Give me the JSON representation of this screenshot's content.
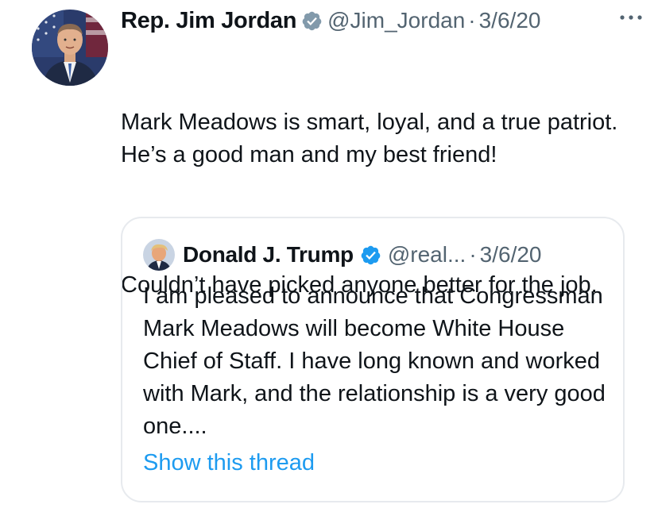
{
  "tweet": {
    "author_name": "Rep. Jim Jordan",
    "handle": "@Jim_Jordan",
    "separator": "·",
    "date": "3/6/20",
    "verified_icon": "verified-badge-icon",
    "more_icon": "more-options-icon",
    "text_paragraphs": [
      "Mark Meadows is smart, loyal, and a true patriot. He’s a good man and my best friend!",
      "Couldn’t have picked anyone better for the job."
    ]
  },
  "quoted_tweet": {
    "author_name": "Donald J. Trump",
    "handle": "@real...",
    "separator": "·",
    "date": "3/6/20",
    "verified_icon": "verified-badge-icon",
    "text": "I am pleased to announce that Congressman Mark Meadows will become White House Chief of Staff. I have long known and worked with Mark, and the relationship is a very good one....",
    "show_thread_label": "Show this thread"
  },
  "colors": {
    "text_primary": "#0f1419",
    "text_secondary": "#536471",
    "link": "#1d9bf0",
    "verified": "#1d9bf0",
    "card_border": "#e7eaee"
  }
}
